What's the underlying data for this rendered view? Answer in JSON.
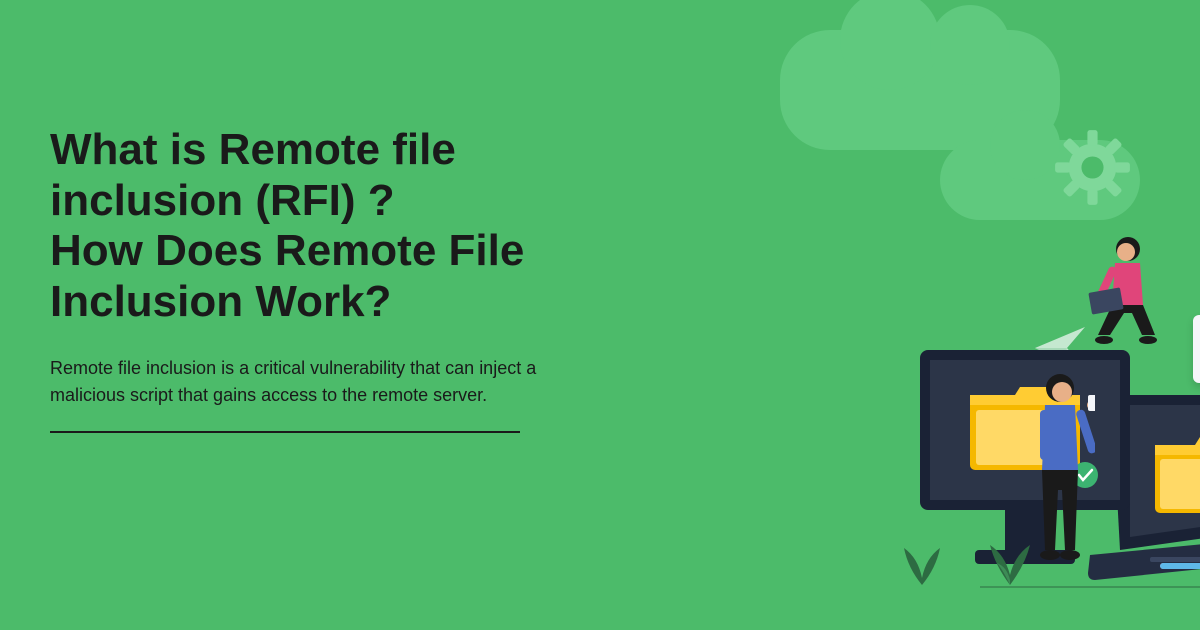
{
  "content": {
    "title_line1": "What is Remote file",
    "title_line2": "inclusion (RFI) ?",
    "title_line3": "How Does Remote File",
    "title_line4": "Inclusion Work?",
    "description": "Remote file inclusion is a critical vulnerability that can inject a malicious script that gains access to the remote server."
  },
  "colors": {
    "background": "#4CBB6A",
    "text": "#1a1a1a",
    "accent_cloud": "#5FC97E",
    "screen_dark": "#2c3548",
    "folder": "#F5B800",
    "doc_bg": "#f5f6fa"
  }
}
